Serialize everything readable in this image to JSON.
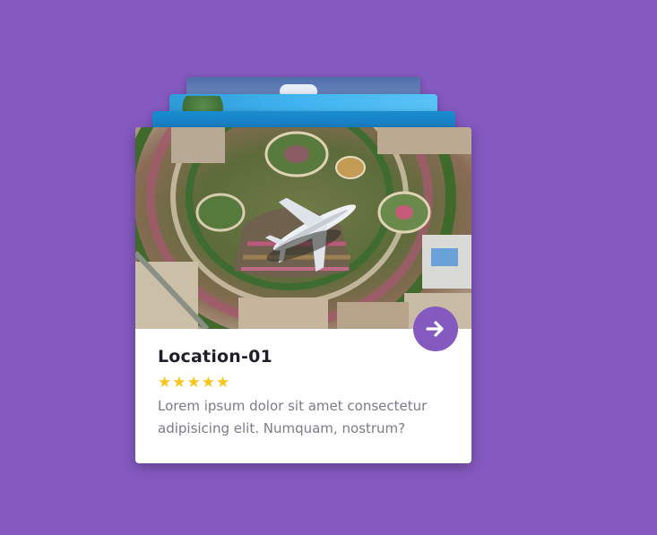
{
  "card": {
    "title": "Location-01",
    "rating": 5,
    "stars": [
      "★",
      "★",
      "★",
      "★",
      "★"
    ],
    "description": "Lorem ipsum dolor sit amet consectetur adipisicing elit. Numquam, nostrum?"
  },
  "colors": {
    "background": "#8459c0",
    "accent": "#8459c0",
    "star": "#f7c519",
    "title": "#1f1f2a",
    "description": "#7b7b85"
  },
  "icons": {
    "next": "arrow-right-icon",
    "rating": "star-icon"
  }
}
